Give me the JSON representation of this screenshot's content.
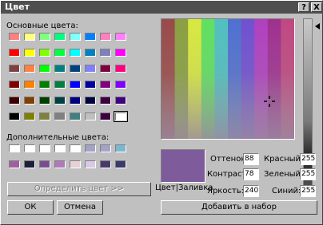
{
  "window": {
    "title": "Цвет",
    "help_label": "?",
    "close_label": "X"
  },
  "basic": {
    "label": "Основные цвета:",
    "colors": [
      [
        "#ff8080",
        "#ffff80",
        "#80ff80",
        "#00ff80",
        "#80ffff",
        "#0080ff",
        "#ff80c0",
        "#ff80ff"
      ],
      [
        "#ff0000",
        "#ffff00",
        "#80ff00",
        "#00ff40",
        "#00ffff",
        "#0080c0",
        "#8080c0",
        "#ff00ff"
      ],
      [
        "#804040",
        "#ff8040",
        "#00ff00",
        "#008080",
        "#004080",
        "#8080ff",
        "#800040",
        "#ff0080"
      ],
      [
        "#800000",
        "#ff8000",
        "#008000",
        "#008040",
        "#0000ff",
        "#0000a0",
        "#800080",
        "#8000ff"
      ],
      [
        "#400000",
        "#804000",
        "#004000",
        "#004040",
        "#000080",
        "#000040",
        "#400040",
        "#400080"
      ],
      [
        "#000000",
        "#808000",
        "#808040",
        "#808080",
        "#408080",
        "#c0c0c0",
        "#400040",
        "#ffffff"
      ]
    ],
    "selected_row": 5,
    "selected_col": 7
  },
  "custom": {
    "label": "Дополнительные цвета:",
    "colors": [
      [
        "#ffffff",
        "#ffffff",
        "#ffffff",
        "#ffffff",
        "#ffffff",
        "#a3a3c8",
        "#a3a3c8",
        "#7cb7d2"
      ],
      [
        "#a060a0",
        "#1e1e3c",
        "#7a4e8e",
        "#b07aba",
        "#e8d0d8",
        "#d8c8e8",
        "#4a3a6a",
        "#3a3a6a"
      ]
    ]
  },
  "buttons": {
    "define": "Определить цвет >>",
    "ok": "ОК",
    "cancel": "Отмена",
    "add": "Добавить в набор"
  },
  "preview": {
    "label": "Цвет|Заливка",
    "color": "#7e5b9a"
  },
  "fields": {
    "hue_label": "Оттенок:",
    "hue": "88",
    "sat_label": "Контраст:",
    "sat": "78",
    "lum_label": "Яркость:",
    "lum": "240",
    "red_label": "Красный:",
    "red": "255",
    "green_label": "Зеленый:",
    "green": "255",
    "blue_label": "Синий:",
    "blue": "255"
  },
  "spectrum_bands": [
    "#9a4a4a",
    "#8aa040",
    "#d8e840",
    "#60e060",
    "#50c0c0",
    "#5070d0",
    "#7050d0",
    "#b040c0",
    "#a03090",
    "#c04880"
  ]
}
